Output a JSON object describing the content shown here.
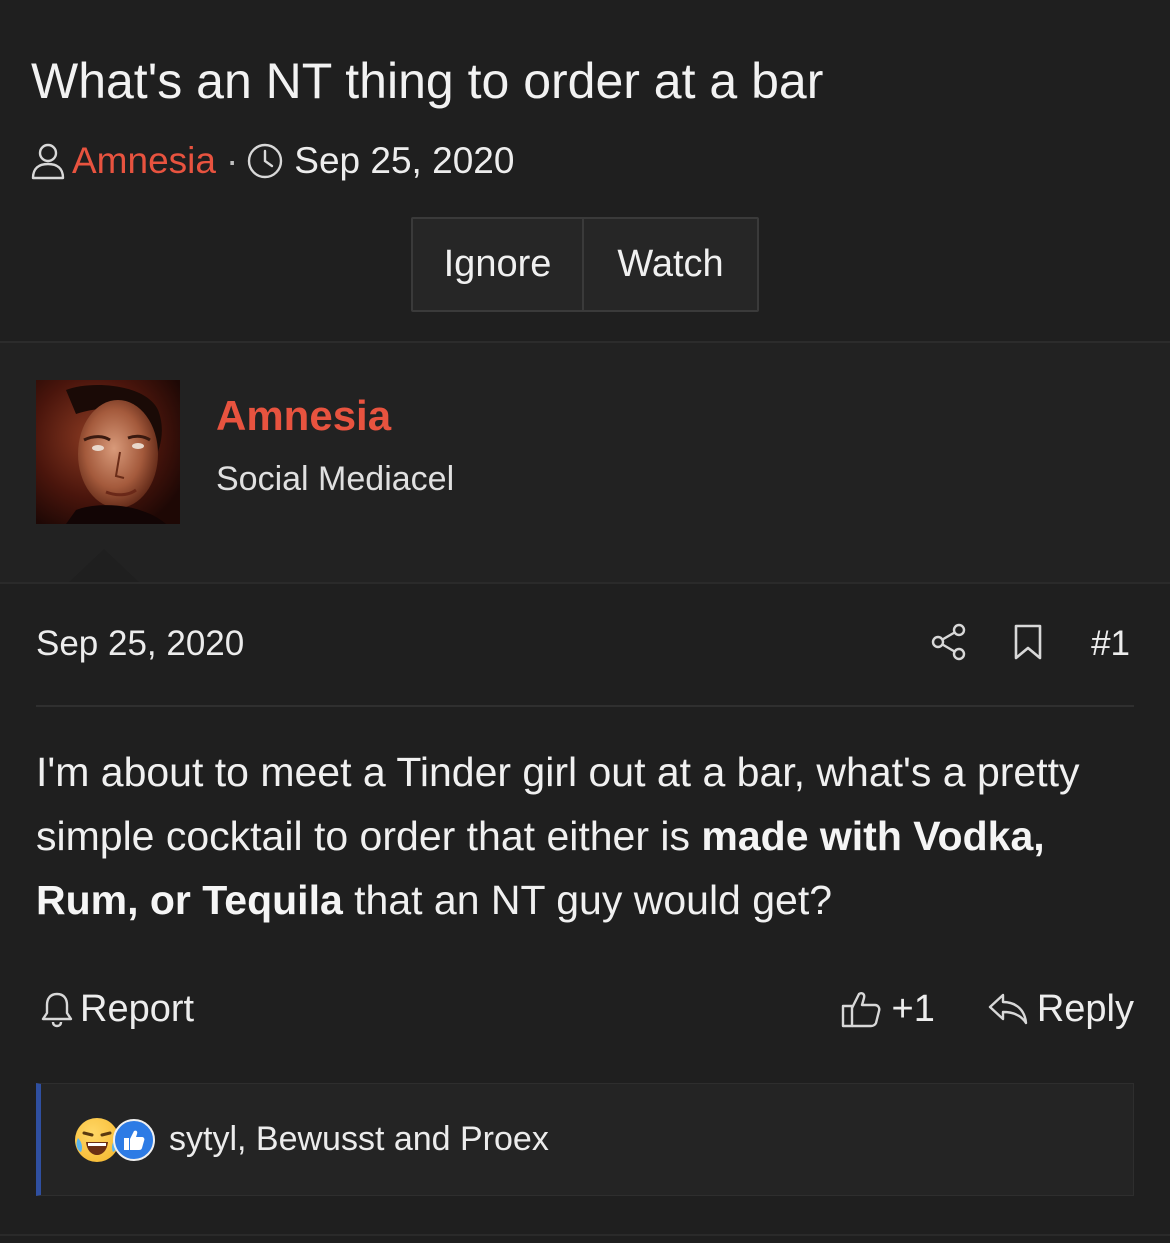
{
  "thread": {
    "title": "What's an NT thing to order at a bar",
    "author": "Amnesia",
    "separator": "·",
    "date": "Sep 25, 2020",
    "buttons": {
      "ignore": "Ignore",
      "watch": "Watch"
    }
  },
  "post": {
    "user": {
      "name": "Amnesia",
      "title": "Social Mediacel"
    },
    "date": "Sep 25, 2020",
    "number": "#1",
    "body": {
      "part1": "I'm about to meet a Tinder girl out at a bar, what's a pretty simple cocktail to order that either is ",
      "bold": "made with Vodka, Rum, or Tequila",
      "part2": " that an NT guy would get?"
    },
    "actions": {
      "report": "Report",
      "like": "+1",
      "reply": "Reply"
    },
    "reactions": {
      "text": "sytyl, Bewusst and Proex"
    }
  },
  "colors": {
    "accent": "#e8533f",
    "background": "#1f1f1f",
    "reaction_bar": "#2f4fa0"
  },
  "icons": [
    "user-icon",
    "clock-icon",
    "share-icon",
    "bookmark-icon",
    "bell-icon",
    "thumbs-up-icon",
    "reply-icon",
    "laugh-emoji-icon",
    "like-emoji-icon"
  ]
}
